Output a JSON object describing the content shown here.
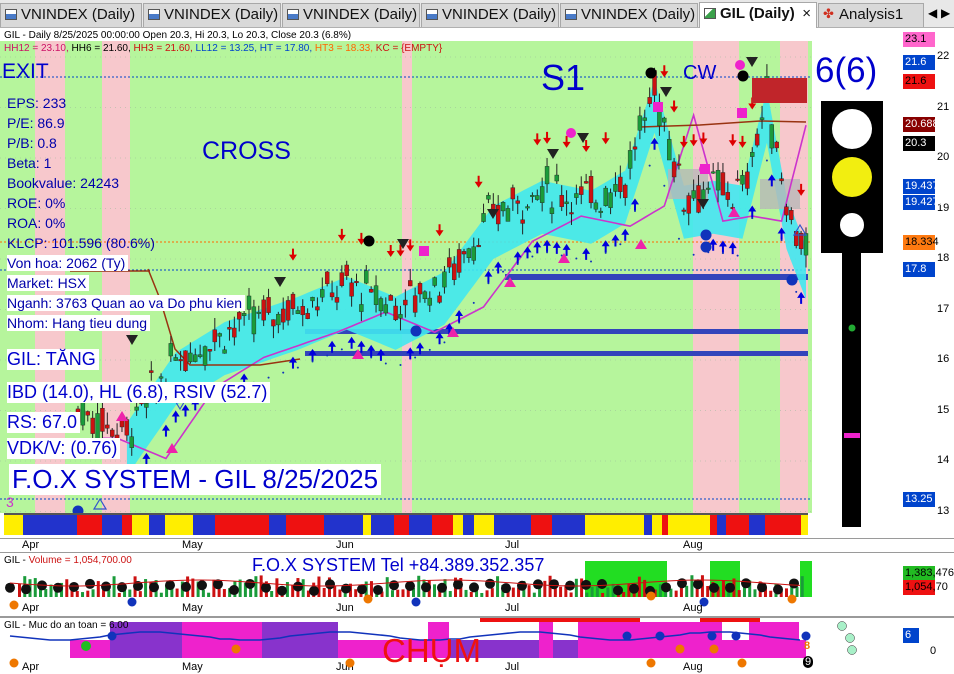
{
  "tabs": [
    {
      "label": "VNINDEX (Daily)",
      "active": false
    },
    {
      "label": "VNINDEX (Daily)",
      "active": false
    },
    {
      "label": "VNINDEX (Daily)",
      "active": false
    },
    {
      "label": "VNINDEX (Daily)",
      "active": false
    },
    {
      "label": "VNINDEX (Daily)",
      "active": false
    },
    {
      "label": "GIL (Daily)",
      "active": true
    },
    {
      "label": "Analysis1",
      "active": false
    }
  ],
  "tab_close": "×",
  "nav_prev": "◀",
  "nav_next": "▶",
  "header": {
    "line1": "GIL - Daily 8/25/2025 00:00:00 Open 20.3, Hi 20.3, Lo 20.3, Close 20.3 (6.8%)",
    "hh12": "HH12 = 23.10,",
    "hh6": "HH6 = 21.60,",
    "hh3": "HH3 = 21.60,",
    "ll12": "LL12 = 13.25,",
    "ht": "HT = 17.80,",
    "ht3": "HT3 = 18.33,",
    "kc": "KC = {EMPTY}"
  },
  "overlay": {
    "exit": "EXIT",
    "s1": "S1",
    "cw": "CW",
    "cross": "CROSS",
    "score": "6(6)",
    "bottom_digit": "3",
    "title": "F.O.X SYSTEM - GIL 8/25/2025",
    "phone": "F.O.X SYSTEM Tel +84.389.352.357",
    "chum": "CHỤM"
  },
  "fundamentals": [
    "EPS: 233",
    "P/E: 86.9",
    "P/B: 0.8",
    "Beta: 1",
    "Bookvalue: 24243",
    "ROE: 0%",
    "ROA: 0%",
    "KLCP: 101.596 (80.6%)",
    "Von hoa: 2062 (Ty)",
    "Market: HSX",
    "Nganh: 3763 Quan ao va Do phu kien",
    "Nhom: Hang tieu dung"
  ],
  "signals": [
    "GIL: TĂNG",
    "IBD (14.0), HL (6.8), RSIV (52.7)",
    "RS: 67.0",
    "VDK/V:  (0.76)"
  ],
  "price_axis": [
    "22",
    "21",
    "20",
    "19",
    "18",
    "17",
    "16",
    "15",
    "14",
    "13"
  ],
  "price_tags": [
    {
      "value": "23.1",
      "bg": "#ff66cc",
      "fg": "#000000"
    },
    {
      "value": "21.6",
      "bg": "#0044cc",
      "fg": "#ffffff"
    },
    {
      "value": "21.6",
      "bg": "#ee1111",
      "fg": "#000000"
    },
    {
      "value": "20.6883",
      "bg": "#880000",
      "fg": "#ffffff"
    },
    {
      "value": "20.3",
      "bg": "#000000",
      "fg": "#ffffff"
    },
    {
      "value": "19.4376",
      "bg": "#0044cc",
      "fg": "#ffffff"
    },
    {
      "value": "19.4275",
      "bg": "#0044cc",
      "fg": "#ffffff"
    },
    {
      "value": "18.334",
      "bg": "#ff7a10",
      "fg": "#000000"
    },
    {
      "value": "17.8",
      "bg": "#0044cc",
      "fg": "#ffffff"
    },
    {
      "value": "13.25",
      "bg": "#0044cc",
      "fg": "#ffffff"
    }
  ],
  "months": [
    "Apr",
    "May",
    "Jun",
    "Jul",
    "Aug"
  ],
  "volume": {
    "label_gil": "GIL -",
    "label_vol": "Volume = 1,054,700.00",
    "tag_high": "1,383,476",
    "tag_val": "1,054,70"
  },
  "safety": {
    "label": "GIL - Muc do an toan = 6.00",
    "tag": "6",
    "axis_zero": "0",
    "marker_zero": "0",
    "marker_eight": "8",
    "marker_nine": "9"
  },
  "colors": {
    "bull_bg": "#b6f59c",
    "pink_band": "#f7c8cc",
    "cyan_cloud": "#40e8f0",
    "ma_line": "#cc33cc",
    "up_candle": "#1a9b3a",
    "down_candle": "#cc1111",
    "text_blue": "#0000cc"
  },
  "chart_data": {
    "type": "candlestick",
    "ticker": "GIL",
    "timeframe": "Daily",
    "last_bar": {
      "date": "8/25/2025",
      "open": 20.3,
      "high": 20.3,
      "low": 20.3,
      "close": 20.3,
      "change_pct": 6.8
    },
    "ylim": [
      12.8,
      22.4
    ],
    "support_lines": [
      17.8,
      16.6,
      16.2
    ],
    "resistance_line": 21.6
  }
}
